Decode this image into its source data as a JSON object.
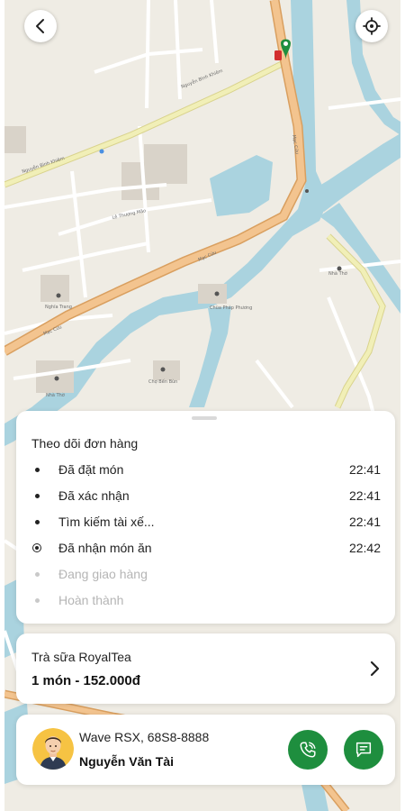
{
  "map": {
    "icons": {
      "back": "chevron-left-icon",
      "locate": "crosshair-icon",
      "destination": "map-pin-icon"
    },
    "colors": {
      "land": "#efece4",
      "water": "#aad3df",
      "main_road": "#f3c48f",
      "secondary_road": "#f1efb7",
      "building": "#d9d3c9"
    }
  },
  "tracking": {
    "title": "Theo dõi đơn hàng",
    "steps": [
      {
        "label": "Đã đặt món",
        "time": "22:41",
        "state": "done"
      },
      {
        "label": "Đã xác nhận",
        "time": "22:41",
        "state": "done"
      },
      {
        "label": "Tìm kiếm tài xế...",
        "time": "22:41",
        "state": "done"
      },
      {
        "label": "Đã nhận món ăn",
        "time": "22:42",
        "state": "current"
      },
      {
        "label": "Đang giao hàng",
        "time": "",
        "state": "pending"
      },
      {
        "label": "Hoàn thành",
        "time": "",
        "state": "pending"
      }
    ]
  },
  "order": {
    "store_name": "Trà sữa RoyalTea",
    "summary": "1 món - 152.000đ",
    "icon": "chevron-right-icon"
  },
  "driver": {
    "vehicle": "Wave RSX, 68S8-8888",
    "name": "Nguyễn Văn Tài",
    "icons": {
      "avatar": "driver-avatar",
      "call": "phone-icon",
      "chat": "message-icon"
    },
    "colors": {
      "action_button": "#1e8e3e"
    }
  }
}
